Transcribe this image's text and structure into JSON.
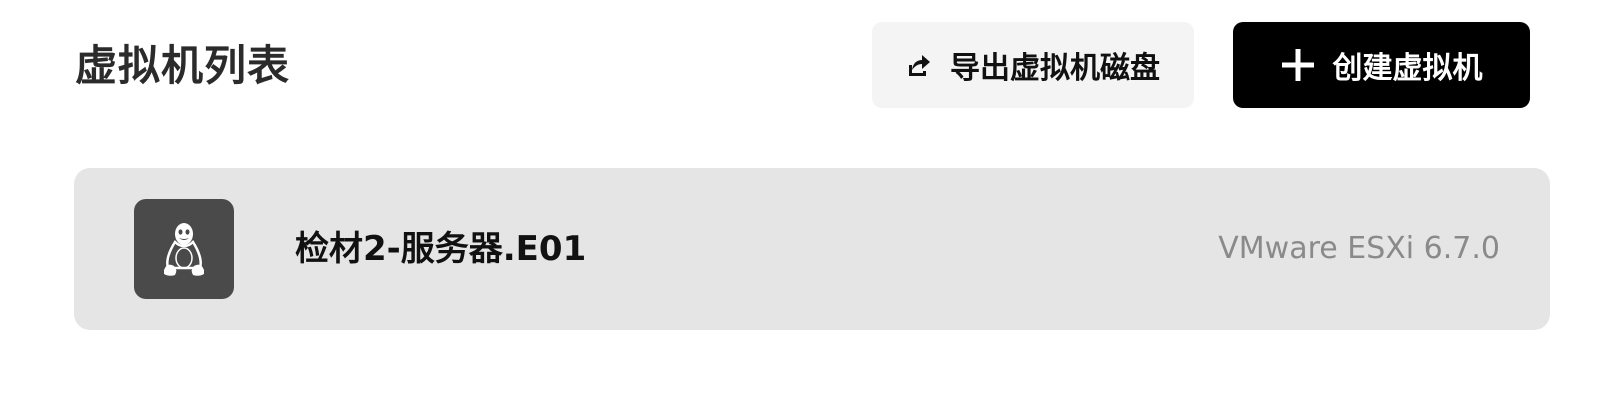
{
  "header": {
    "title": "虚拟机列表"
  },
  "toolbar": {
    "export_label": "导出虚拟机磁盘",
    "export_icon": "export-share-icon",
    "create_label": "创建虚拟机",
    "create_icon": "plus-icon"
  },
  "vm_list": [
    {
      "name": "检材2-服务器.E01",
      "platform": "VMware ESXi 6.7.0",
      "os_icon": "linux-tux-icon"
    }
  ],
  "colors": {
    "create_button_bg": "#000000",
    "export_button_bg": "#f4f4f4",
    "card_bg": "#e5e5e5",
    "os_badge_bg": "#4a4a4a",
    "platform_text": "#8a8a8a"
  }
}
